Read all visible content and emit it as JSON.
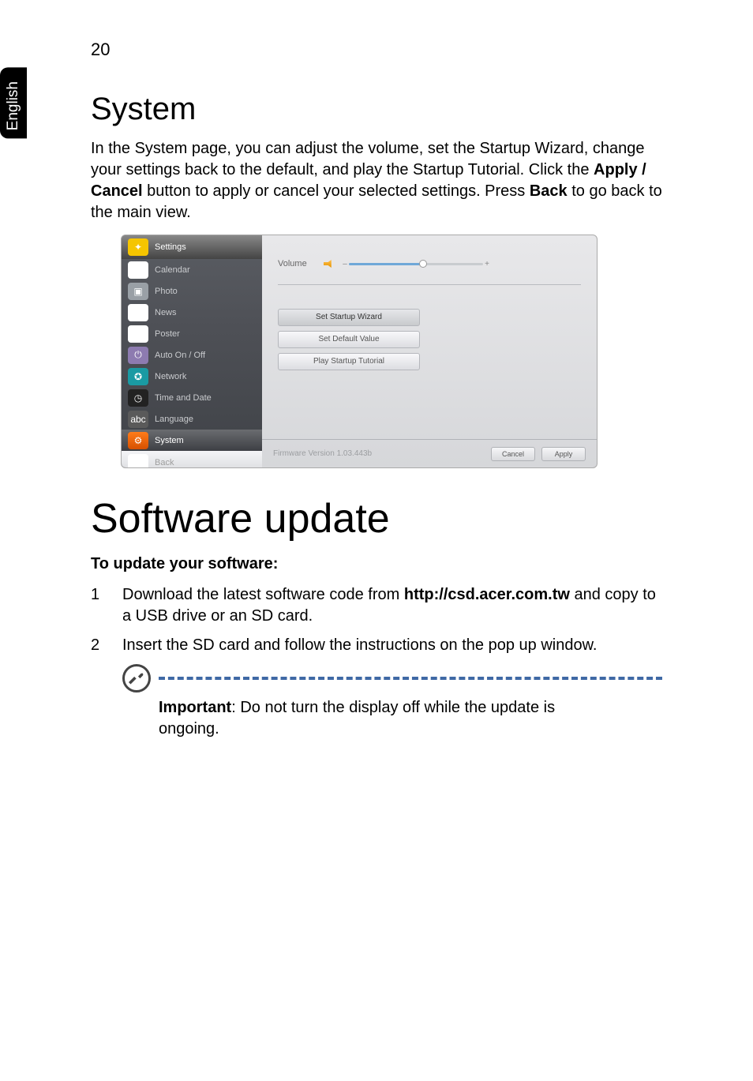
{
  "pageNumber": "20",
  "sideTab": "English",
  "section1": {
    "title": "System",
    "para_a": "In the System page, you can adjust the volume, set the Startup Wizard, change your settings back to the default, and play the Startup Tutorial. Click the ",
    "apply_cancel": "Apply / Cancel",
    "para_b": " button to apply or cancel your selected settings. Press ",
    "back_word": "Back",
    "para_c": " to go back to the main view."
  },
  "screenshot": {
    "sidebar": [
      {
        "label": "Settings",
        "style": "settings-row",
        "icon": "sb-settings",
        "glyph": "✦"
      },
      {
        "label": "Calendar",
        "style": "",
        "icon": "sb-white",
        "glyph": "9"
      },
      {
        "label": "Photo",
        "style": "",
        "icon": "sb-gray",
        "glyph": "▣"
      },
      {
        "label": "News",
        "style": "",
        "icon": "sb-white",
        "glyph": "እ"
      },
      {
        "label": "Poster",
        "style": "",
        "icon": "sb-white",
        "glyph": "▭"
      },
      {
        "label": "Auto On / Off",
        "style": "",
        "icon": "sb-purple",
        "glyph": "⏻"
      },
      {
        "label": "Network",
        "style": "",
        "icon": "sb-cyan",
        "glyph": "✪"
      },
      {
        "label": "Time and Date",
        "style": "",
        "icon": "sb-time",
        "glyph": "◷"
      },
      {
        "label": "Language",
        "style": "",
        "icon": "sb-abc",
        "glyph": "abc"
      },
      {
        "label": "System",
        "style": "system-row",
        "icon": "sb-system",
        "glyph": "⚙"
      },
      {
        "label": "Back",
        "style": "back-row",
        "icon": "sb-back",
        "glyph": "↶"
      }
    ],
    "volume_label": "Volume",
    "minus": "–",
    "plus": "+",
    "buttons": {
      "wizard": "Set Startup Wizard",
      "default": "Set Default Value",
      "tutorial": "Play Startup Tutorial"
    },
    "firmware": "Firmware Version  1.03.443b",
    "cancel": "Cancel",
    "apply": "Apply"
  },
  "section2": {
    "title": "Software update",
    "subhead": "To update your software:",
    "steps": [
      {
        "n": "1",
        "a": "Download the latest software code from ",
        "bold": "http://csd.acer.com.tw",
        "b": " and copy to a USB drive or an SD card."
      },
      {
        "n": "2",
        "a": "Insert the SD card and follow the instructions on the pop up window.",
        "bold": "",
        "b": ""
      }
    ],
    "note_bold": "Important",
    "note_rest": ": Do not turn the display off while the update is ongoing."
  }
}
